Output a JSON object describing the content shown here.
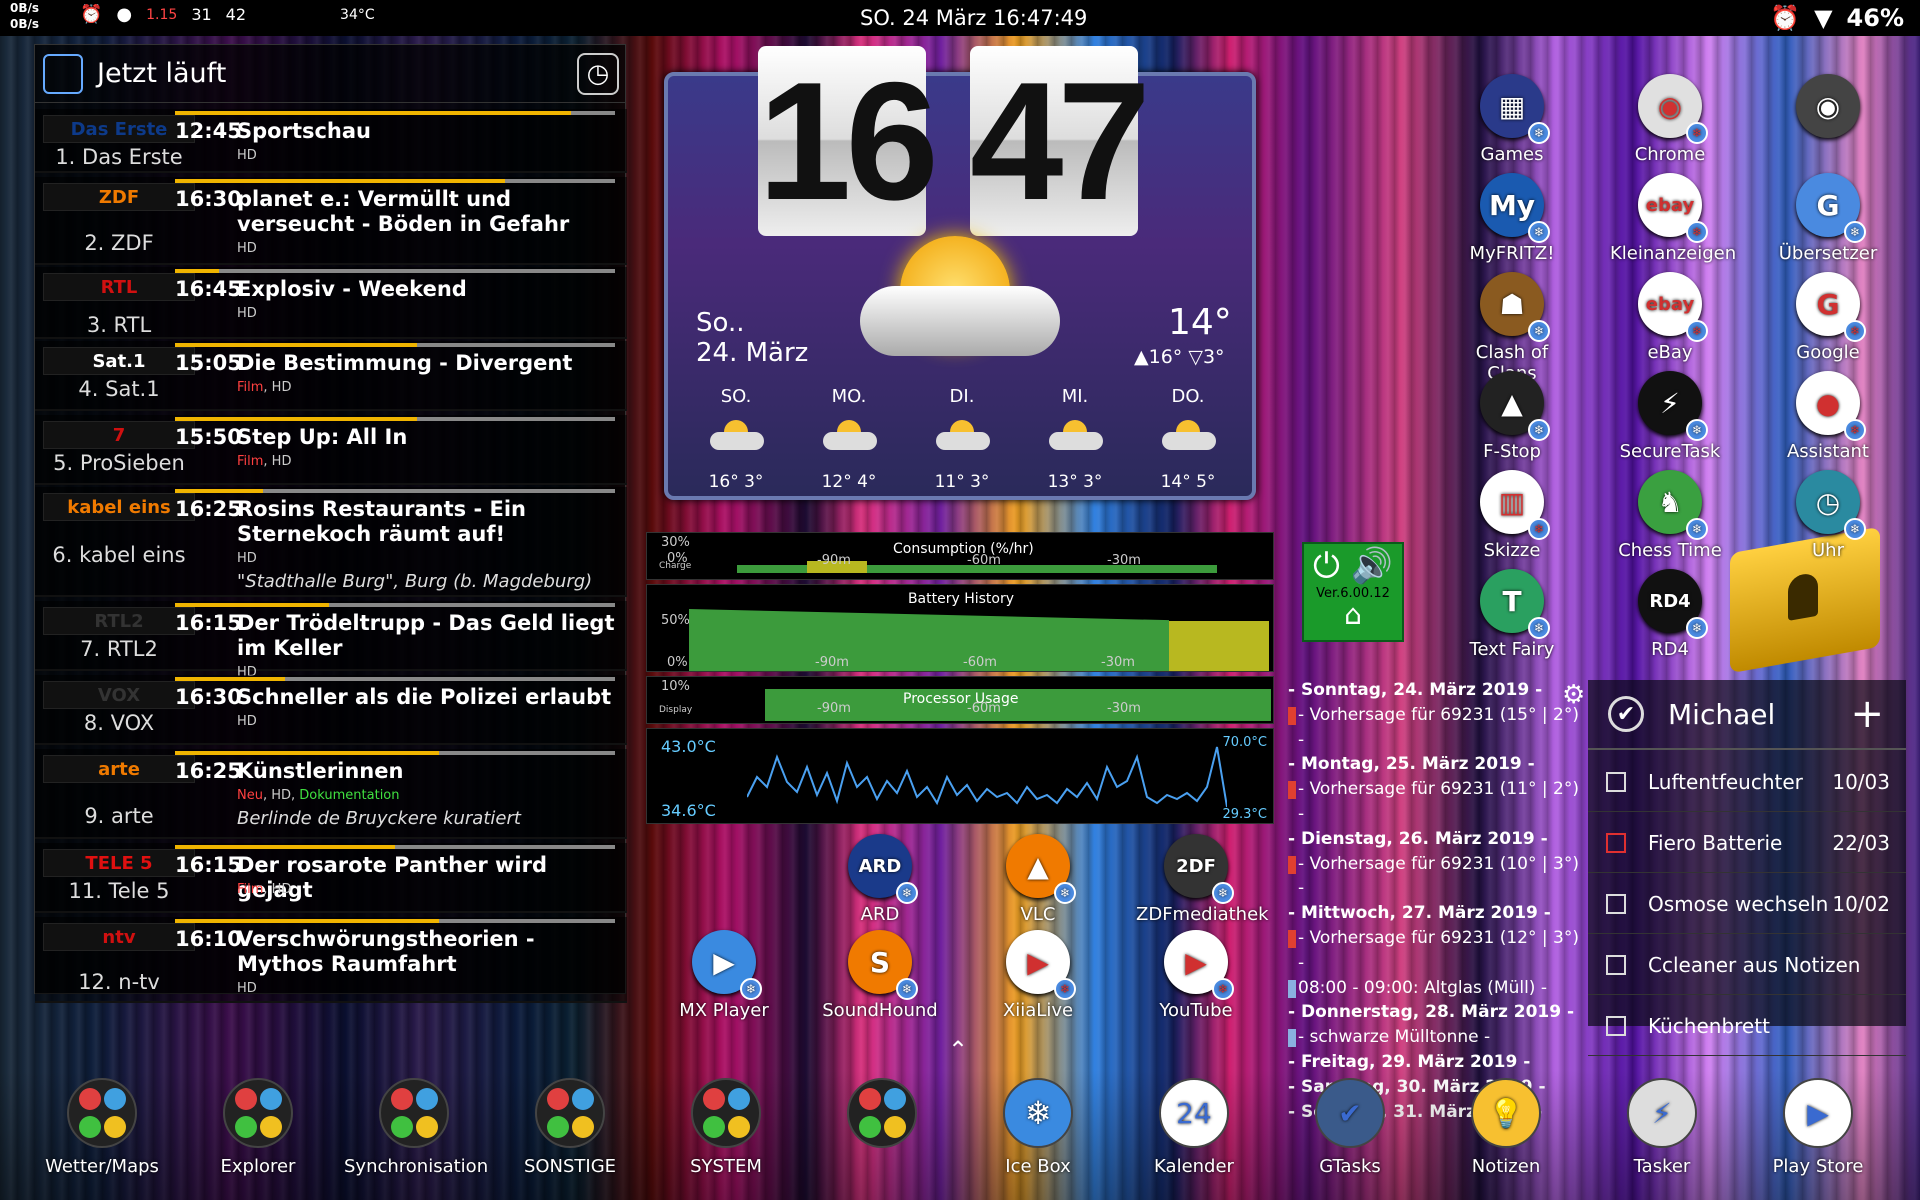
{
  "status": {
    "net_up": "0B/s",
    "net_down": "0B/s",
    "val1": "1.15",
    "val2": "31",
    "val3": "42",
    "temp": "34°C",
    "datetime": "SO. 24 März 16:47:49",
    "battery": "46%"
  },
  "tv": {
    "title": "Jetzt läuft",
    "rows": [
      {
        "logo": "Das Erste",
        "channel": "1. Das Erste",
        "time": "12:45",
        "title": "Sportschau",
        "tags": "HD",
        "progress": 0.9,
        "logo_color": "#0d3a8a"
      },
      {
        "logo": "ZDF",
        "channel": "2. ZDF",
        "time": "16:30",
        "title": "planet e.: Vermüllt und verseucht - Böden in Gefahr",
        "tags": "HD",
        "progress": 0.75,
        "logo_color": "#f07a00"
      },
      {
        "logo": "RTL",
        "channel": "3. RTL",
        "time": "16:45",
        "title": "Explosiv - Weekend",
        "tags": "HD",
        "progress": 0.1,
        "logo_color": "#d01010"
      },
      {
        "logo": "Sat.1",
        "channel": "4. Sat.1",
        "time": "15:05",
        "title": "Die Bestimmung - Divergent",
        "tag_red": "Film",
        "tags": ", HD",
        "progress": 0.55,
        "logo_color": "#fff"
      },
      {
        "logo": "7",
        "channel": "5. ProSieben",
        "time": "15:50",
        "title": "Step Up: All In",
        "tag_red": "Film",
        "tags": ", HD",
        "progress": 0.55,
        "logo_color": "#d01010"
      },
      {
        "logo": "kabel eins",
        "channel": "6. kabel eins",
        "time": "16:25",
        "title": "Rosins Restaurants - Ein Sternekoch räumt auf!",
        "tags": "HD",
        "desc": "\"Stadthalle Burg\", Burg (b. Magdeburg)",
        "progress": 0.2,
        "logo_color": "#f07a00"
      },
      {
        "logo": "RTL2",
        "channel": "7. RTL2",
        "time": "16:15",
        "title": "Der Trödeltrupp - Das Geld liegt im Keller",
        "tags": "HD",
        "progress": 0.35,
        "logo_color": "#333"
      },
      {
        "logo": "VOX",
        "channel": "8. VOX",
        "time": "16:30",
        "title": "Schneller als die Polizei erlaubt",
        "tags": "HD",
        "progress": 0.25,
        "logo_color": "#333"
      },
      {
        "logo": "arte",
        "channel": "9. arte",
        "time": "16:25",
        "title": "Künstlerinnen",
        "tag_red": "Neu",
        "tags": ", HD, ",
        "tag_green": "Dokumentation",
        "desc": "Berlinde de Bruyckere kuratiert",
        "progress": 0.6,
        "logo_color": "#f07a00"
      },
      {
        "logo": "TELE 5",
        "channel": "11. Tele 5",
        "time": "16:15",
        "title": "Der rosarote Panther wird gejagt",
        "tag_red": "Film",
        "tags": ", HD",
        "progress": 0.5,
        "logo_color": "#e01010"
      },
      {
        "logo": "ntv",
        "channel": "12. n-tv",
        "time": "16:10",
        "title": "Verschwörungstheorien - Mythos Raumfahrt",
        "tags": "HD",
        "progress": 0.6,
        "logo_color": "#d01010"
      }
    ]
  },
  "clock": {
    "hours": "16",
    "minutes": "47",
    "day": "So..",
    "date": "24. März",
    "temp": "14°",
    "hi": "▲16°",
    "lo": "▽3°",
    "forecast": [
      {
        "d": "SO.",
        "t": "16°  3°"
      },
      {
        "d": "MO.",
        "t": "12°  4°"
      },
      {
        "d": "DI.",
        "t": "11°  3°"
      },
      {
        "d": "MI.",
        "t": "13°  3°"
      },
      {
        "d": "DO.",
        "t": "14°  5°"
      }
    ]
  },
  "battery": {
    "consumption_title": "Consumption (%/hr)",
    "c_top": "30%",
    "c_mid": "0%",
    "c_lbl": "Charge",
    "history_title": "Battery History",
    "h_top": "50%",
    "h_bot": "0%",
    "proc_title": "Processor Usage",
    "p_top": "10%",
    "p_lbl": "Display",
    "t_hi": "43.0°C",
    "t_lo": "34.6°C",
    "t_max": "70.0°C",
    "t_min": "29.3°C",
    "ticks": [
      "-90m",
      "-60m",
      "-30m"
    ]
  },
  "power": {
    "version": "Ver.6.00.12"
  },
  "apps_right": [
    {
      "n": "Games",
      "c": "#2a3a8a",
      "g": "▦"
    },
    {
      "n": "Chrome",
      "c": "#e0e0e0",
      "g": "◉"
    },
    {
      "n": "",
      "c": "#444",
      "g": "◉"
    },
    {
      "n": "MyFRITZ!",
      "c": "#1a5ab0",
      "g": "My"
    },
    {
      "n": "Kleinanzeigen",
      "c": "#fff",
      "g": "ebay"
    },
    {
      "n": "Übersetzer",
      "c": "#4a8ae0",
      "g": "G"
    },
    {
      "n": "Clash of Clans",
      "c": "#8a5a20",
      "g": "☗"
    },
    {
      "n": "eBay",
      "c": "#fff",
      "g": "ebay"
    },
    {
      "n": "Google",
      "c": "#fff",
      "g": "G"
    },
    {
      "n": "F-Stop",
      "c": "#222",
      "g": "▲"
    },
    {
      "n": "SecureTask",
      "c": "#111",
      "g": "⚡"
    },
    {
      "n": "Assistant",
      "c": "#fff",
      "g": "●"
    },
    {
      "n": "Skizze",
      "c": "#fff",
      "g": "▥"
    },
    {
      "n": "Chess Time",
      "c": "#3aa040",
      "g": "♞"
    },
    {
      "n": "Uhr",
      "c": "#2a8aa0",
      "g": "◷"
    },
    {
      "n": "Text Fairy",
      "c": "#2aa060",
      "g": "T"
    },
    {
      "n": "RD4",
      "c": "#111",
      "g": "RD4"
    }
  ],
  "apps_mid": [
    {
      "n": "ARD",
      "c": "#1a3a8a",
      "g": "ARD"
    },
    {
      "n": "VLC",
      "c": "#f07a00",
      "g": "▲"
    },
    {
      "n": "ZDFmediathek",
      "c": "#333",
      "g": "2DF"
    },
    {
      "n": "MX Player",
      "c": "#3a8ae0",
      "g": "▶"
    },
    {
      "n": "SoundHound",
      "c": "#f07a00",
      "g": "S"
    },
    {
      "n": "XiiaLive",
      "c": "#fff",
      "g": "▶"
    },
    {
      "n": "YouTube",
      "c": "#fff",
      "g": "▶"
    }
  ],
  "calendar": [
    {
      "t": "- Sonntag, 24. März 2019 -",
      "k": "n"
    },
    {
      "t": "- Vorhersage für 69231 (15° | 2°) -",
      "k": "s"
    },
    {
      "t": "- Montag, 25. März 2019 -",
      "k": "n"
    },
    {
      "t": "- Vorhersage für 69231 (11° | 2°) -",
      "k": "s"
    },
    {
      "t": "- Dienstag, 26. März 2019 -",
      "k": "n"
    },
    {
      "t": "- Vorhersage für 69231 (10° | 3°) -",
      "k": "s"
    },
    {
      "t": "- Mittwoch, 27. März 2019 -",
      "k": "n"
    },
    {
      "t": "- Vorhersage für 69231 (12° | 3°) -",
      "k": "s"
    },
    {
      "t": "08:00 - 09:00: Altglas (Müll) -",
      "k": "sb"
    },
    {
      "t": "- Donnerstag, 28. März 2019 -",
      "k": "n"
    },
    {
      "t": "- schwarze Mülltonne -",
      "k": "sb"
    },
    {
      "t": "- Freitag, 29. März 2019 -",
      "k": "n"
    },
    {
      "t": "- Samstag, 30. März 2019 -",
      "k": "n"
    },
    {
      "t": "- Sonntag, 31. März 2019 -",
      "k": "n"
    }
  ],
  "tasks": {
    "name": "Michael",
    "add": "+",
    "items": [
      {
        "t": "Luftentfeuchter",
        "d": "10/03"
      },
      {
        "t": "Fiero Batterie",
        "d": "22/03",
        "red": true
      },
      {
        "t": "Osmose wechseln",
        "d": "10/02"
      },
      {
        "t": "Ccleaner aus Notizen",
        "d": ""
      },
      {
        "t": "Küchenbrett",
        "d": ""
      }
    ]
  },
  "dock": [
    {
      "n": "Wetter/Maps"
    },
    {
      "n": "Explorer"
    },
    {
      "n": "Synchronisation"
    },
    {
      "n": "SONSTIGE"
    },
    {
      "n": "SYSTEM"
    },
    {
      "n": ""
    },
    {
      "n": "Ice Box"
    },
    {
      "n": "Kalender",
      "g": "24"
    },
    {
      "n": "GTasks",
      "g": "✔"
    },
    {
      "n": "Notizen",
      "g": "💡"
    },
    {
      "n": "Tasker",
      "g": "⚡"
    },
    {
      "n": "Play Store",
      "g": "▶"
    }
  ]
}
